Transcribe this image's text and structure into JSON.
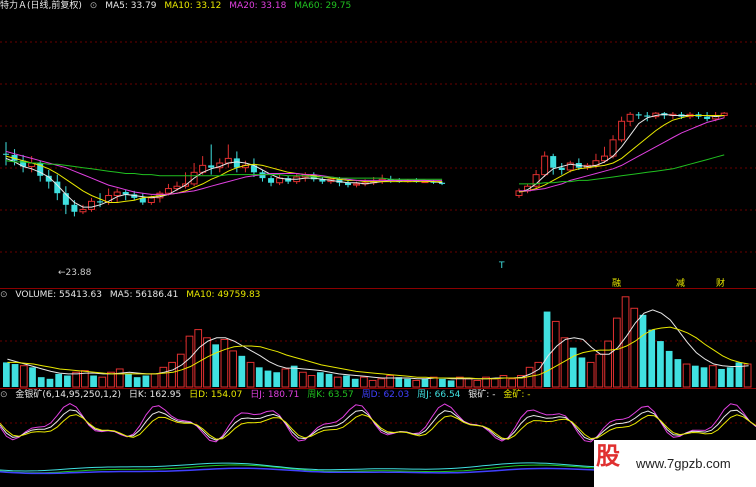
{
  "colors": {
    "white": "#e8e8e8",
    "yellow": "#e8e800",
    "magenta": "#e040e0",
    "green": "#20c020",
    "cyan": "#40e0e0",
    "red": "#e03030",
    "blue": "#4040ff",
    "grid": "#8b0000"
  },
  "main": {
    "title": "特力Ａ(日线,前复权)",
    "ma5": "MA5: 33.79",
    "ma10": "MA10: 33.12",
    "ma20": "MA20: 33.18",
    "ma60": "MA60: 29.75",
    "low_label": "23.88",
    "t_marker": "T",
    "event_1": "融",
    "event_2": "减",
    "event_3": "财"
  },
  "volume": {
    "label": "VOLUME: 55413.63",
    "ma5": "MA5: 56186.41",
    "ma10": "MA10: 49759.83"
  },
  "indicator": {
    "label": "金银矿(6,14,95,250,1,2)",
    "rik": "日K: 162.95",
    "rid": "日D: 154.07",
    "rij": "日J: 180.71",
    "zhouk": "周K: 63.57",
    "zhoud": "周D: 62.03",
    "zhouj": "周J: 66.54",
    "yinkuang": "银矿: -",
    "jinkuang": "金矿: -"
  },
  "watermark": {
    "logo": "股",
    "text": "www.7gpzb.com"
  },
  "candles": [
    [
      64,
      64,
      54,
      74,
      "c"
    ],
    [
      63,
      58,
      54,
      68,
      "c"
    ],
    [
      58,
      53,
      48,
      63,
      "c"
    ],
    [
      53,
      56,
      48,
      62,
      "r"
    ],
    [
      56,
      45,
      40,
      58,
      "c"
    ],
    [
      45,
      40,
      34,
      50,
      "c"
    ],
    [
      40,
      30,
      24,
      46,
      "c"
    ],
    [
      30,
      20,
      12,
      36,
      "c"
    ],
    [
      20,
      14,
      10,
      24,
      "c"
    ],
    [
      14,
      16,
      12,
      20,
      "r"
    ],
    [
      16,
      23,
      14,
      26,
      "r"
    ],
    [
      23,
      22,
      18,
      30,
      "c"
    ],
    [
      22,
      28,
      20,
      34,
      "r"
    ],
    [
      28,
      31,
      22,
      34,
      "r"
    ],
    [
      31,
      29,
      24,
      33,
      "c"
    ],
    [
      29,
      26,
      24,
      32,
      "c"
    ],
    [
      26,
      22,
      20,
      30,
      "c"
    ],
    [
      22,
      26,
      20,
      28,
      "r"
    ],
    [
      26,
      30,
      22,
      32,
      "r"
    ],
    [
      30,
      34,
      28,
      38,
      "r"
    ],
    [
      34,
      36,
      32,
      40,
      "r"
    ],
    [
      36,
      38,
      34,
      48,
      "r"
    ],
    [
      38,
      48,
      36,
      56,
      "r"
    ],
    [
      48,
      54,
      46,
      62,
      "r"
    ],
    [
      54,
      52,
      46,
      72,
      "c"
    ],
    [
      52,
      56,
      48,
      60,
      "r"
    ],
    [
      56,
      60,
      52,
      72,
      "r"
    ],
    [
      60,
      52,
      48,
      66,
      "c"
    ],
    [
      52,
      54,
      48,
      58,
      "r"
    ],
    [
      54,
      48,
      44,
      60,
      "c"
    ],
    [
      48,
      43,
      40,
      50,
      "c"
    ],
    [
      43,
      39,
      36,
      45,
      "c"
    ],
    [
      39,
      43,
      37,
      46,
      "r"
    ],
    [
      43,
      40,
      38,
      45,
      "c"
    ],
    [
      40,
      44,
      38,
      47,
      "r"
    ],
    [
      44,
      46,
      40,
      48,
      "r"
    ],
    [
      46,
      42,
      40,
      48,
      "c"
    ],
    [
      42,
      40,
      38,
      44,
      "c"
    ],
    [
      40,
      42,
      38,
      44,
      "r"
    ],
    [
      42,
      39,
      36,
      44,
      "c"
    ],
    [
      39,
      37,
      35,
      41,
      "c"
    ],
    [
      37,
      38,
      35,
      40,
      "r"
    ],
    [
      38,
      39,
      36,
      42,
      "r"
    ],
    [
      39,
      40,
      37,
      44,
      "r"
    ],
    [
      40,
      42,
      38,
      46,
      "r"
    ],
    [
      42,
      41,
      39,
      45,
      "c"
    ],
    [
      41,
      40,
      39,
      43,
      "c"
    ],
    [
      40,
      41,
      39,
      42,
      "r"
    ],
    [
      41,
      40,
      39,
      43,
      "c"
    ],
    [
      40,
      40,
      39,
      41,
      "r"
    ],
    [
      40,
      39,
      38,
      41,
      "c"
    ],
    [
      39,
      38,
      37,
      40,
      "c"
    ],
    [
      null,
      null,
      null,
      null,
      "x"
    ],
    [
      null,
      null,
      null,
      null,
      "x"
    ],
    [
      null,
      null,
      null,
      null,
      "x"
    ],
    [
      null,
      null,
      null,
      null,
      "x"
    ],
    [
      null,
      null,
      null,
      null,
      "x"
    ],
    [
      null,
      null,
      null,
      null,
      "x"
    ],
    [
      null,
      null,
      null,
      null,
      "x"
    ],
    [
      null,
      null,
      null,
      null,
      "x"
    ],
    [
      28,
      32,
      26,
      34,
      "r"
    ],
    [
      32,
      36,
      30,
      38,
      "r"
    ],
    [
      36,
      46,
      34,
      50,
      "r"
    ],
    [
      46,
      62,
      44,
      66,
      "r"
    ],
    [
      62,
      52,
      46,
      64,
      "c"
    ],
    [
      52,
      50,
      46,
      56,
      "c"
    ],
    [
      50,
      56,
      48,
      58,
      "r"
    ],
    [
      56,
      52,
      50,
      60,
      "c"
    ],
    [
      52,
      54,
      50,
      56,
      "r"
    ],
    [
      54,
      58,
      52,
      64,
      "r"
    ],
    [
      58,
      62,
      56,
      70,
      "r"
    ],
    [
      62,
      76,
      60,
      80,
      "r"
    ],
    [
      76,
      92,
      74,
      96,
      "r"
    ],
    [
      92,
      98,
      88,
      100,
      "r"
    ],
    [
      98,
      97,
      94,
      100,
      "c"
    ],
    [
      97,
      96,
      92,
      100,
      "c"
    ],
    [
      96,
      99,
      94,
      100,
      "r"
    ],
    [
      99,
      97,
      94,
      100,
      "c"
    ],
    [
      97,
      98,
      94,
      100,
      "r"
    ],
    [
      98,
      96,
      94,
      100,
      "c"
    ],
    [
      96,
      98,
      94,
      100,
      "r"
    ],
    [
      98,
      96,
      94,
      100,
      "c"
    ],
    [
      96,
      94,
      92,
      100,
      "c"
    ],
    [
      94,
      97,
      92,
      100,
      "r"
    ],
    [
      97,
      99,
      95,
      100,
      "r"
    ]
  ],
  "ma_lines": {
    "ma5": [
      60,
      57,
      53,
      51,
      48,
      44,
      37,
      29,
      22,
      18,
      18,
      20,
      23,
      27,
      29,
      28,
      27,
      26,
      27,
      29,
      33,
      37,
      43,
      48,
      51,
      53,
      56,
      57,
      56,
      54,
      50,
      46,
      43,
      42,
      42,
      43,
      43,
      42,
      41,
      40,
      39,
      39,
      38,
      39,
      40,
      41,
      41,
      41,
      41,
      41,
      40,
      39,
      null,
      null,
      null,
      null,
      null,
      null,
      null,
      null,
      31,
      33,
      38,
      45,
      51,
      53,
      55,
      54,
      53,
      54,
      57,
      62,
      70,
      80,
      90,
      95,
      97,
      98,
      97,
      97,
      97,
      97,
      97,
      96,
      97
    ],
    "ma10": [
      62,
      60,
      58,
      56,
      54,
      51,
      47,
      42,
      37,
      32,
      28,
      25,
      22,
      22,
      23,
      24,
      26,
      27,
      28,
      29,
      30,
      32,
      35,
      38,
      42,
      45,
      49,
      52,
      54,
      55,
      54,
      52,
      50,
      48,
      47,
      46,
      45,
      44,
      43,
      42,
      41,
      41,
      40,
      40,
      40,
      40,
      40,
      40,
      40,
      40,
      40,
      40,
      null,
      null,
      null,
      null,
      null,
      null,
      null,
      null,
      31,
      32,
      34,
      37,
      41,
      45,
      49,
      51,
      52,
      53,
      54,
      56,
      60,
      66,
      72,
      78,
      84,
      89,
      93,
      95,
      97,
      97,
      97,
      97,
      97
    ],
    "ma20": [
      66,
      64,
      62,
      60,
      58,
      56,
      54,
      52,
      49,
      46,
      43,
      40,
      37,
      35,
      33,
      31,
      30,
      29,
      29,
      29,
      30,
      31,
      32,
      34,
      36,
      38,
      40,
      42,
      44,
      45,
      46,
      47,
      47,
      47,
      47,
      46,
      46,
      45,
      44,
      43,
      42,
      41,
      41,
      41,
      41,
      41,
      41,
      41,
      41,
      41,
      41,
      41,
      null,
      null,
      null,
      null,
      null,
      null,
      null,
      null,
      32,
      32,
      33,
      34,
      36,
      38,
      41,
      43,
      45,
      47,
      49,
      51,
      54,
      58,
      62,
      66,
      70,
      74,
      78,
      82,
      85,
      88,
      91,
      93,
      95
    ],
    "ma60": [
      58,
      57,
      57,
      56,
      56,
      55,
      55,
      54,
      53,
      52,
      51,
      50,
      49,
      48,
      47,
      47,
      46,
      46,
      45,
      45,
      45,
      45,
      45,
      45,
      45,
      45,
      46,
      46,
      46,
      46,
      46,
      46,
      46,
      45,
      45,
      45,
      44,
      44,
      44,
      43,
      43,
      43,
      43,
      43,
      43,
      42,
      42,
      42,
      42,
      42,
      42,
      42,
      null,
      null,
      null,
      null,
      null,
      null,
      null,
      null,
      38,
      38,
      38,
      39,
      39,
      40,
      40,
      41,
      41,
      42,
      43,
      44,
      45,
      46,
      47,
      48,
      49,
      50,
      51,
      53,
      55,
      57,
      59,
      61,
      63
    ]
  },
  "volumes": [
    [
      30,
      "c"
    ],
    [
      28,
      "c"
    ],
    [
      26,
      "r"
    ],
    [
      24,
      "c"
    ],
    [
      12,
      "c"
    ],
    [
      10,
      "c"
    ],
    [
      16,
      "c"
    ],
    [
      14,
      "c"
    ],
    [
      18,
      "r"
    ],
    [
      20,
      "r"
    ],
    [
      14,
      "c"
    ],
    [
      12,
      "r"
    ],
    [
      18,
      "r"
    ],
    [
      22,
      "r"
    ],
    [
      16,
      "c"
    ],
    [
      12,
      "c"
    ],
    [
      14,
      "c"
    ],
    [
      16,
      "r"
    ],
    [
      24,
      "r"
    ],
    [
      30,
      "r"
    ],
    [
      40,
      "r"
    ],
    [
      62,
      "r"
    ],
    [
      70,
      "r"
    ],
    [
      60,
      "r"
    ],
    [
      52,
      "c"
    ],
    [
      58,
      "r"
    ],
    [
      44,
      "r"
    ],
    [
      38,
      "c"
    ],
    [
      30,
      "r"
    ],
    [
      24,
      "c"
    ],
    [
      20,
      "c"
    ],
    [
      18,
      "c"
    ],
    [
      22,
      "r"
    ],
    [
      26,
      "c"
    ],
    [
      18,
      "r"
    ],
    [
      14,
      "r"
    ],
    [
      18,
      "c"
    ],
    [
      16,
      "c"
    ],
    [
      12,
      "r"
    ],
    [
      14,
      "c"
    ],
    [
      10,
      "c"
    ],
    [
      12,
      "r"
    ],
    [
      8,
      "r"
    ],
    [
      10,
      "r"
    ],
    [
      14,
      "r"
    ],
    [
      12,
      "c"
    ],
    [
      10,
      "c"
    ],
    [
      8,
      "r"
    ],
    [
      10,
      "c"
    ],
    [
      12,
      "r"
    ],
    [
      10,
      "c"
    ],
    [
      8,
      "c"
    ],
    [
      12,
      "r"
    ],
    [
      10,
      "r"
    ],
    [
      8,
      "r"
    ],
    [
      12,
      "r"
    ],
    [
      10,
      "r"
    ],
    [
      14,
      "r"
    ],
    [
      10,
      "r"
    ],
    [
      14,
      "r"
    ],
    [
      24,
      "r"
    ],
    [
      30,
      "r"
    ],
    [
      92,
      "c"
    ],
    [
      80,
      "r"
    ],
    [
      60,
      "r"
    ],
    [
      48,
      "c"
    ],
    [
      36,
      "c"
    ],
    [
      30,
      "r"
    ],
    [
      40,
      "r"
    ],
    [
      56,
      "r"
    ],
    [
      84,
      "r"
    ],
    [
      110,
      "r"
    ],
    [
      96,
      "r"
    ],
    [
      88,
      "c"
    ],
    [
      70,
      "c"
    ],
    [
      56,
      "c"
    ],
    [
      44,
      "c"
    ],
    [
      34,
      "c"
    ],
    [
      28,
      "r"
    ],
    [
      26,
      "c"
    ],
    [
      24,
      "c"
    ],
    [
      26,
      "r"
    ],
    [
      22,
      "c"
    ],
    [
      24,
      "c"
    ],
    [
      30,
      "c"
    ],
    [
      28,
      "r"
    ]
  ],
  "vol_ma5": [
    34,
    31,
    28,
    25,
    22,
    19,
    17,
    16,
    16,
    17,
    17,
    16,
    16,
    17,
    18,
    17,
    16,
    16,
    18,
    21,
    27,
    36,
    48,
    56,
    60,
    60,
    56,
    50,
    44,
    38,
    31,
    26,
    23,
    23,
    22,
    21,
    20,
    18,
    16,
    15,
    14,
    13,
    12,
    11,
    11,
    11,
    11,
    10,
    10,
    11,
    11,
    10,
    10,
    10,
    10,
    10,
    11,
    11,
    11,
    12,
    16,
    22,
    38,
    50,
    58,
    60,
    58,
    48,
    40,
    40,
    48,
    62,
    78,
    90,
    94,
    90,
    82,
    68,
    54,
    42,
    34,
    28,
    26,
    25,
    25,
    26
  ],
  "vol_ma10": [
    30,
    30,
    29,
    28,
    26,
    24,
    22,
    21,
    20,
    19,
    18,
    17,
    16,
    16,
    16,
    16,
    16,
    16,
    17,
    18,
    21,
    25,
    31,
    37,
    42,
    46,
    49,
    50,
    50,
    49,
    46,
    43,
    39,
    36,
    33,
    30,
    27,
    25,
    23,
    21,
    19,
    18,
    17,
    16,
    15,
    14,
    13,
    12,
    12,
    11,
    11,
    11,
    11,
    11,
    10,
    10,
    10,
    11,
    11,
    11,
    13,
    15,
    20,
    26,
    32,
    38,
    42,
    44,
    45,
    45,
    46,
    50,
    56,
    64,
    70,
    72,
    73,
    70,
    66,
    60,
    52,
    45,
    38,
    33,
    30,
    28
  ]
}
